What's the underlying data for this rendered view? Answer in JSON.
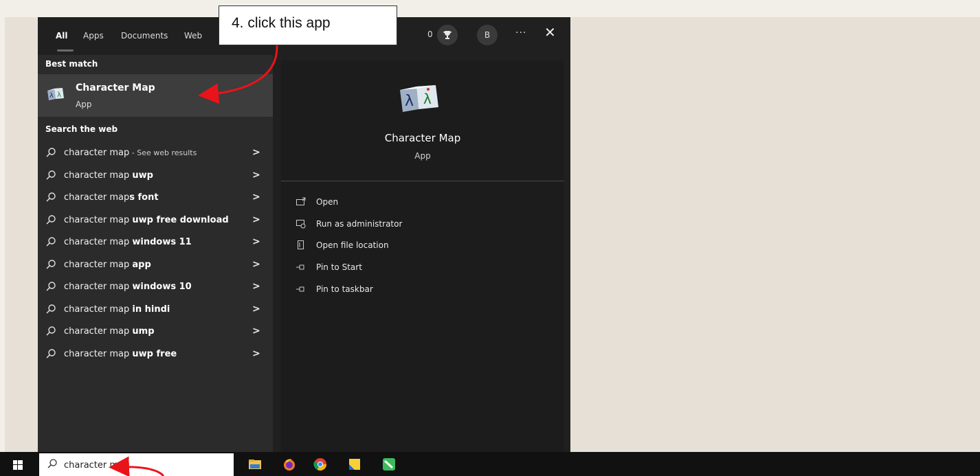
{
  "tabs": [
    {
      "label": "All",
      "active": true
    },
    {
      "label": "Apps"
    },
    {
      "label": "Documents"
    },
    {
      "label": "Web"
    }
  ],
  "header": {
    "points": "0",
    "avatar_letter": "B",
    "more": "···",
    "close": "✕"
  },
  "callout": {
    "text": "4. click this app"
  },
  "best_match": {
    "section_label": "Best match",
    "title": "Character Map",
    "subtitle": "App"
  },
  "web": {
    "section_label": "Search the web",
    "items": [
      {
        "prefix": "character map",
        "bold": "",
        "suffix": " - See web results"
      },
      {
        "prefix": "character map ",
        "bold": "uwp",
        "suffix": ""
      },
      {
        "prefix": "character map",
        "bold": "s font",
        "suffix": ""
      },
      {
        "prefix": "character map ",
        "bold": "uwp free download",
        "suffix": ""
      },
      {
        "prefix": "character map ",
        "bold": "windows 11",
        "suffix": ""
      },
      {
        "prefix": "character map ",
        "bold": "app",
        "suffix": ""
      },
      {
        "prefix": "character map ",
        "bold": "windows 10",
        "suffix": ""
      },
      {
        "prefix": "character map ",
        "bold": "in hindi",
        "suffix": ""
      },
      {
        "prefix": "character map ",
        "bold": "ump",
        "suffix": ""
      },
      {
        "prefix": "character map ",
        "bold": "uwp free",
        "suffix": ""
      }
    ]
  },
  "detail": {
    "title": "Character Map",
    "type": "App",
    "actions": [
      {
        "label": "Open",
        "icon": "open-icon"
      },
      {
        "label": "Run as administrator",
        "icon": "run-admin-icon"
      },
      {
        "label": "Open file location",
        "icon": "folder-icon"
      },
      {
        "label": "Pin to Start",
        "icon": "pin-icon"
      },
      {
        "label": "Pin to taskbar",
        "icon": "pin-icon"
      }
    ]
  },
  "taskbar": {
    "search_value": "character map",
    "icons": [
      "file-explorer-icon",
      "firefox-icon",
      "chrome-icon",
      "sticky-notes-icon",
      "app-icon"
    ]
  },
  "colors": {
    "panel": "#202020",
    "left_pane": "#2b2b2b",
    "selected": "#3d3d3d",
    "annotation": "#e8141a"
  }
}
